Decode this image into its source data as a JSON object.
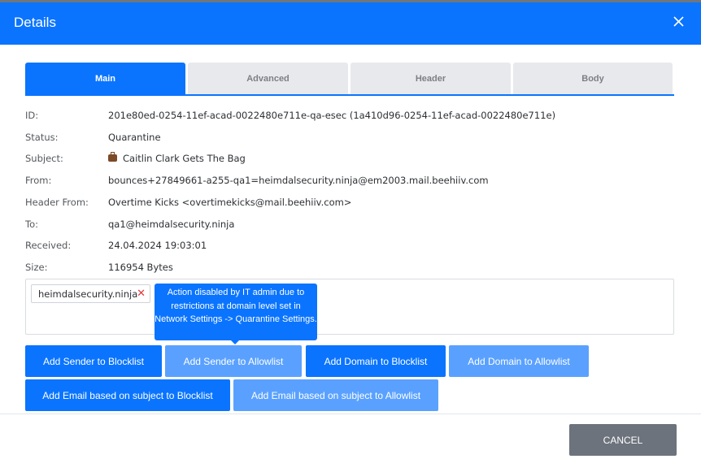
{
  "dialog": {
    "title": "Details",
    "close_icon": "close-icon"
  },
  "tabs": [
    {
      "label": "Main",
      "active": true
    },
    {
      "label": "Advanced",
      "active": false
    },
    {
      "label": "Header",
      "active": false
    },
    {
      "label": "Body",
      "active": false
    }
  ],
  "details": {
    "id": {
      "label": "ID:",
      "value": "201e80ed-0254-11ef-acad-0022480e711e-qa-esec (1a410d96-0254-11ef-acad-0022480e711e)"
    },
    "status": {
      "label": "Status:",
      "value": "Quarantine"
    },
    "subject": {
      "label": "Subject:",
      "value": "Caitlin Clark Gets The Bag",
      "icon": "briefcase-icon"
    },
    "from": {
      "label": "From:",
      "value": "bounces+27849661-a255-qa1=heimdalsecurity.ninja@em2003.mail.beehiiv.com"
    },
    "header_from": {
      "label": "Header From:",
      "value": "Overtime Kicks <overtimekicks@mail.beehiiv.com>"
    },
    "to": {
      "label": "To:",
      "value": "qa1@heimdalsecurity.ninja"
    },
    "received": {
      "label": "Received:",
      "value": "24.04.2024 19:03:01"
    },
    "size": {
      "label": "Size:",
      "value": "116954 Bytes"
    }
  },
  "domain_chip": {
    "label": "heimdalsecurity.ninja",
    "remove_symbol": "✕"
  },
  "tooltip": {
    "text": "Action disabled by IT admin due to restrictions at domain level set in Network Settings -> Quarantine Settings."
  },
  "actions": {
    "sender_blocklist": "Add Sender to Blocklist",
    "sender_allowlist": "Add Sender to Allowlist",
    "domain_blocklist": "Add Domain to Blocklist",
    "domain_allowlist": "Add Domain to Allowlist",
    "email_subject_blocklist": "Add Email based on subject to Blocklist",
    "email_subject_allowlist": "Add Email based on subject to Allowlist"
  },
  "footer": {
    "cancel_label": "CANCEL"
  },
  "colors": {
    "accent": "#0a74ff",
    "disabled_button": "#5aa1ff",
    "cancel_button": "#6c737c",
    "remove_x": "#e0393b"
  }
}
